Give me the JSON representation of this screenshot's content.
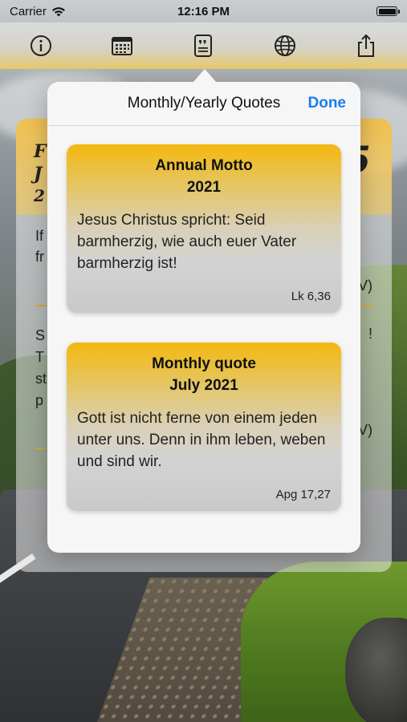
{
  "status_bar": {
    "carrier": "Carrier",
    "time": "12:16 PM"
  },
  "toolbar": {
    "icons": [
      "info-icon",
      "calendar-icon",
      "quote-card-icon",
      "globe-icon",
      "share-icon"
    ]
  },
  "popover": {
    "title": "Monthly/Yearly Quotes",
    "done_label": "Done",
    "cards": [
      {
        "heading_line1": "Annual Motto",
        "heading_line2": "2021",
        "text": "Jesus Christus spricht: Seid barmherzig, wie auch euer Vater barmherzig ist!",
        "reference": "Lk 6,36"
      },
      {
        "heading_line1": "Monthly quote",
        "heading_line2": "July 2021",
        "text": "Gott ist nicht ferne von einem jeden unter uns. Denn in ihm leben, weben und sind wir.",
        "reference": "Apg 17,27"
      }
    ]
  },
  "background_card": {
    "fragments": [
      "F",
      "J",
      "2",
      "If",
      "fr",
      "S",
      "T",
      "st",
      "p",
      "5",
      "V)",
      "!",
      "V)"
    ]
  },
  "colors": {
    "accent_blue": "#1a7cf0",
    "card_gold": "#f4b80e",
    "toolbar_gold": "#e6c86a"
  }
}
